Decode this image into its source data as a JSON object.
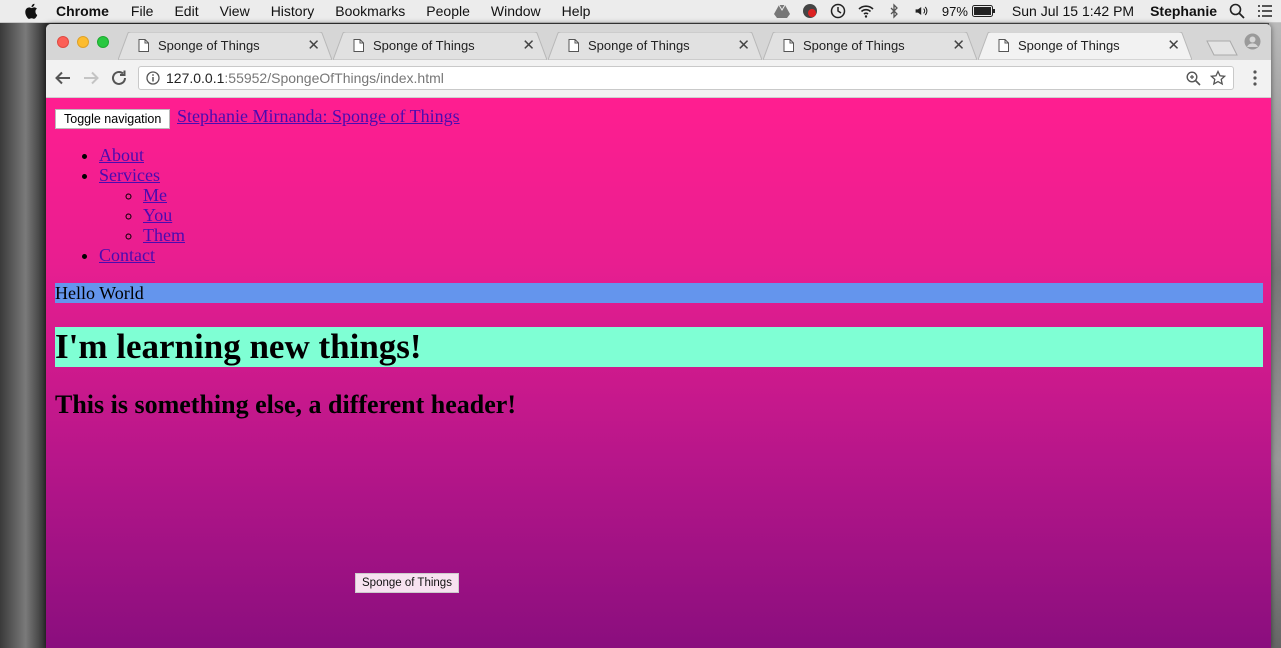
{
  "menubar": {
    "app_name": "Chrome",
    "items": [
      "File",
      "Edit",
      "View",
      "History",
      "Bookmarks",
      "People",
      "Window",
      "Help"
    ],
    "battery": "97%",
    "clock": "Sun Jul 15  1:42 PM",
    "user": "Stephanie"
  },
  "tabs": [
    {
      "title": "Sponge of Things",
      "active": false
    },
    {
      "title": "Sponge of Things",
      "active": false
    },
    {
      "title": "Sponge of Things",
      "active": false
    },
    {
      "title": "Sponge of Things",
      "active": false
    },
    {
      "title": "Sponge of Things",
      "active": true
    }
  ],
  "toolbar": {
    "url_host": "127.0.0.1",
    "url_path": ":55952/SpongeOfThings/index.html"
  },
  "page": {
    "toggle_button": "Toggle navigation",
    "brand": "Stephanie Mirnanda: Sponge of Things",
    "nav": {
      "about": "About",
      "services": "Services",
      "services_sub": [
        "Me",
        "You",
        "Them"
      ],
      "contact": "Contact"
    },
    "hello": "Hello World",
    "heading1": "I'm learning new things!",
    "heading2": "This is something else, a different header!",
    "tooltip": "Sponge of Things"
  },
  "colors": {
    "page_gradient_top": "#ff1e90",
    "page_gradient_bottom": "#8a0e7e",
    "hello_bg": "#6495ed",
    "heading1_bg": "#7fffd4",
    "link": "#4a0bb0"
  }
}
